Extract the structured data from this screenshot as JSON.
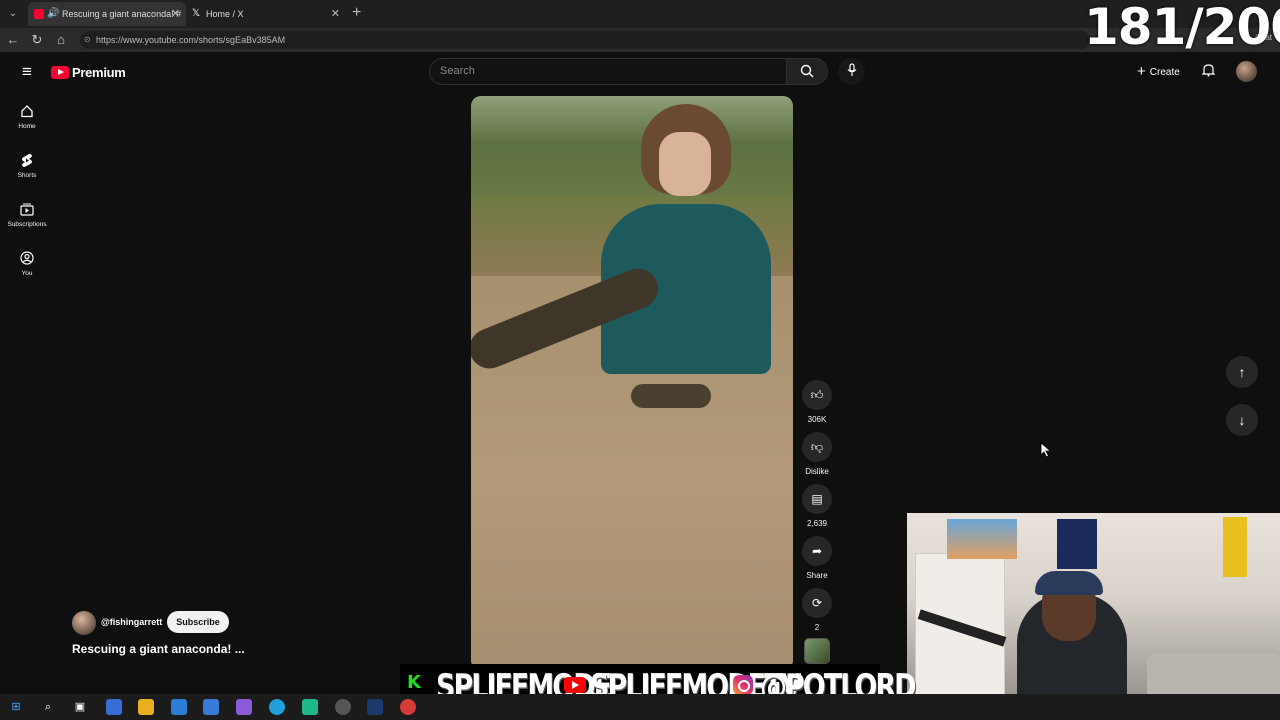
{
  "browser": {
    "tabs": [
      {
        "label": "Rescuing a giant anaconda! #",
        "active": true
      },
      {
        "label": "Home / X",
        "active": false
      }
    ],
    "url": "https://www.youtube.com/shorts/sgEaBv385AM",
    "chat_label": "Chat"
  },
  "overlay_counter": "181/200",
  "header": {
    "logo_text": "Premium",
    "search_placeholder": "Search",
    "create_label": "Create"
  },
  "rail": [
    {
      "label": "Home",
      "icon": "home-icon"
    },
    {
      "label": "Shorts",
      "icon": "shorts-icon"
    },
    {
      "label": "Subscriptions",
      "icon": "subscriptions-icon"
    },
    {
      "label": "You",
      "icon": "you-icon"
    }
  ],
  "short": {
    "likes": "306K",
    "dislike_label": "Dislike",
    "comments": "2,639",
    "share_label": "Share",
    "remix_count": "2",
    "channel": "@fishingarrett",
    "subscribe_label": "Subscribe",
    "title": "Rescuing a giant anaconda! ..."
  },
  "stream_overlay": {
    "kick_letter": "K",
    "handle1": "SPLIFFMODE",
    "handle2": "SPLIFFMODETV",
    "handle3": "@POTLORD"
  },
  "colors": {
    "background": "#0f0f0f",
    "youtube_red": "#ff0033",
    "kick_green": "#1adf1a"
  }
}
